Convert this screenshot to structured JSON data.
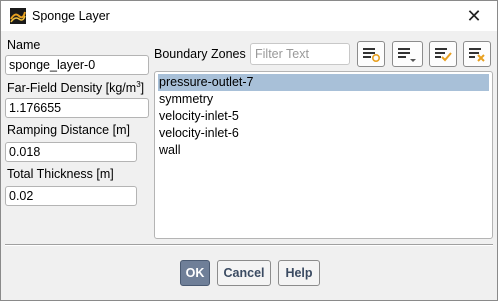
{
  "window": {
    "title": "Sponge Layer",
    "close_glyph": "✕"
  },
  "form": {
    "name_label": "Name",
    "name_value": "sponge_layer-0",
    "density_label_prefix": "Far-Field Density [kg/m",
    "density_label_sup": "3",
    "density_label_suffix": "]",
    "density_value": "1.176655",
    "ramping_label": "Ramping Distance [m]",
    "ramping_value": "0.018",
    "thickness_label": "Total Thickness [m]",
    "thickness_value": "0.02"
  },
  "zones": {
    "label": "Boundary Zones",
    "filter_placeholder": "Filter Text",
    "items": [
      "pressure-outlet-7",
      "symmetry",
      "velocity-inlet-5",
      "velocity-inlet-6",
      "wall"
    ],
    "selected_index": 0,
    "toolbar_icons": [
      "select-all-icon",
      "list-options-icon",
      "select-checked-icon",
      "deselect-all-icon"
    ]
  },
  "buttons": {
    "ok": "OK",
    "cancel": "Cancel",
    "help": "Help"
  },
  "colors": {
    "selection": "#a8c0d8",
    "primary_button": "#6f7f98",
    "accent_orange": "#e8a020"
  }
}
